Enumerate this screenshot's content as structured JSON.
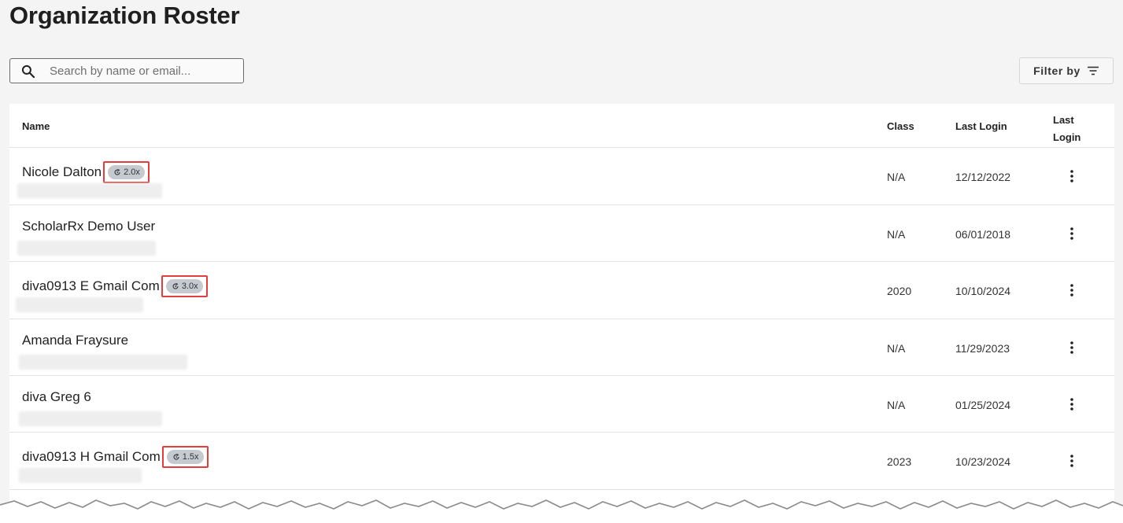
{
  "page": {
    "title": "Organization Roster"
  },
  "search": {
    "placeholder": "Search by name or email...",
    "icon": "search-icon"
  },
  "filter": {
    "label": "Filter by",
    "icon": "filter-lines-icon"
  },
  "table": {
    "columns": {
      "name": "Name",
      "class": "Class",
      "last_login": "Last Login",
      "actions": "Last Login"
    },
    "rows": [
      {
        "name": "Nicole Dalton",
        "badge": "2.0x",
        "class": "N/A",
        "last_login": "12/12/2022"
      },
      {
        "name": "ScholarRx Demo User",
        "badge": "",
        "class": "N/A",
        "last_login": "06/01/2018"
      },
      {
        "name": "diva0913 E Gmail Com",
        "badge": "3.0x",
        "class": "2020",
        "last_login": "10/10/2024"
      },
      {
        "name": "Amanda Fraysure",
        "badge": "",
        "class": "N/A",
        "last_login": "11/29/2023"
      },
      {
        "name": "diva Greg 6",
        "badge": "",
        "class": "N/A",
        "last_login": "01/25/2024"
      },
      {
        "name": "diva0913 H Gmail Com",
        "badge": "1.5x",
        "class": "2023",
        "last_login": "10/23/2024"
      }
    ]
  },
  "colors": {
    "background": "#f4f4f4",
    "card": "#ffffff",
    "badge": "#c5cad1",
    "highlight_border": "#e63c3c",
    "divider": "#e3e3e3"
  }
}
